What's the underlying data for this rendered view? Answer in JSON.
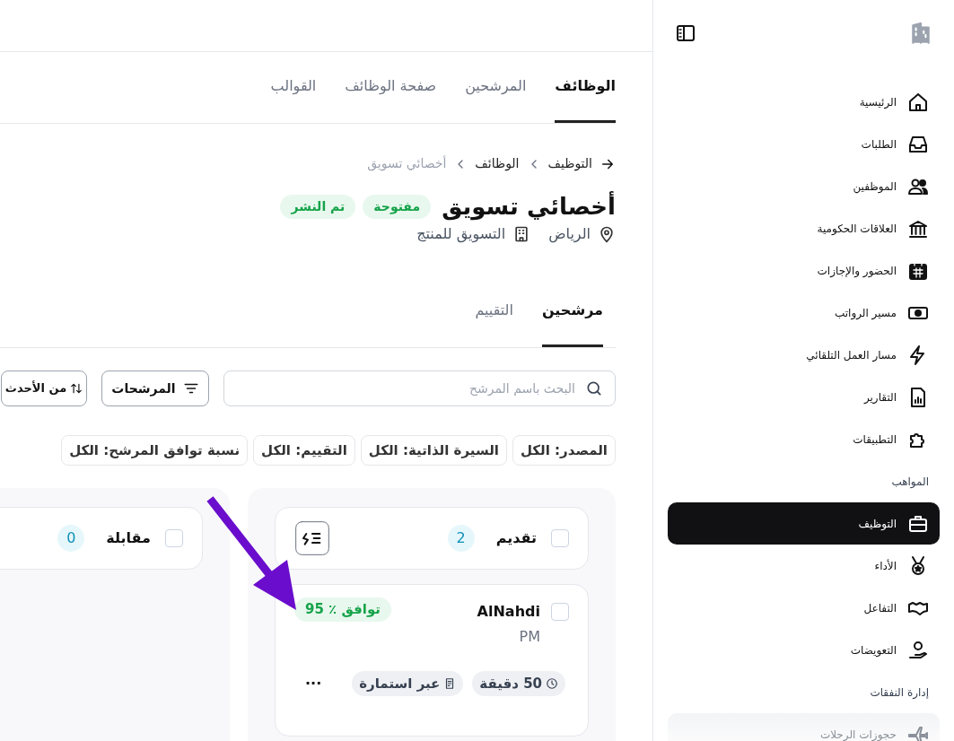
{
  "sidebar": {
    "items": [
      {
        "kind": "link",
        "label": "الرئيسية",
        "selected": false,
        "disabled": false
      },
      {
        "kind": "link",
        "label": "الطلبات",
        "selected": false,
        "disabled": false
      },
      {
        "kind": "link",
        "label": "الموظفين",
        "selected": false,
        "disabled": false
      },
      {
        "kind": "link",
        "label": "العلاقات الحكومية",
        "selected": false,
        "disabled": false
      },
      {
        "kind": "link",
        "label": "الحضور والإجازات",
        "selected": false,
        "disabled": false
      },
      {
        "kind": "link",
        "label": "مسير الرواتب",
        "selected": false,
        "disabled": false
      },
      {
        "kind": "link",
        "label": "مسار العمل التلقائي",
        "selected": false,
        "disabled": false
      },
      {
        "kind": "link",
        "label": "التقارير",
        "selected": false,
        "disabled": false
      },
      {
        "kind": "link",
        "label": "التطبيقات",
        "selected": false,
        "disabled": false
      },
      {
        "kind": "section",
        "label": "المواهب"
      },
      {
        "kind": "link",
        "label": "التوظيف",
        "selected": true,
        "disabled": false
      },
      {
        "kind": "link",
        "label": "الأداء",
        "selected": false,
        "disabled": false
      },
      {
        "kind": "link",
        "label": "التفاعل",
        "selected": false,
        "disabled": false
      },
      {
        "kind": "link",
        "label": "التعويضات",
        "selected": false,
        "disabled": false
      },
      {
        "kind": "section",
        "label": "إدارة النفقات"
      },
      {
        "kind": "link",
        "label": "حجوزات الرحلات",
        "selected": false,
        "disabled": true
      }
    ]
  },
  "top_tabs": [
    {
      "label": "الوظائف",
      "selected": true
    },
    {
      "label": "المرشحين",
      "selected": false
    },
    {
      "label": "صفحة الوظائف",
      "selected": false
    },
    {
      "label": "القوالب",
      "selected": false
    }
  ],
  "breadcrumb": [
    "التوظيف",
    "الوظائف",
    "أخصائي تسويق"
  ],
  "job": {
    "title": "أخصائي تسويق",
    "badges": [
      "مفتوحة",
      "تم النشر"
    ],
    "location": "الرياض",
    "department": "التسويق للمنتج"
  },
  "sub_tabs": [
    {
      "label": "مرشحين",
      "selected": true
    },
    {
      "label": "التقييم",
      "selected": false
    }
  ],
  "search": {
    "placeholder": "البحث باسم المرشح"
  },
  "filters_button": "المرشحات",
  "sort_button": "من الأحدث",
  "chips": [
    "المصدر: الكل",
    "السيرة الذاتية: الكل",
    "التقييم: الكل",
    "نسبة توافق المرشح: الكل"
  ],
  "columns": [
    {
      "title": "تقديم",
      "count": "2",
      "checked": false,
      "cards": [
        {
          "name": "AlNahdi",
          "role": "PM",
          "match": "توافق ٪ 95",
          "duration": "50 دقيقة",
          "source": "عبر استمارة",
          "checked": false,
          "menu": "..."
        }
      ]
    },
    {
      "title": "مقابلة",
      "count": "0",
      "checked": false
    }
  ]
}
